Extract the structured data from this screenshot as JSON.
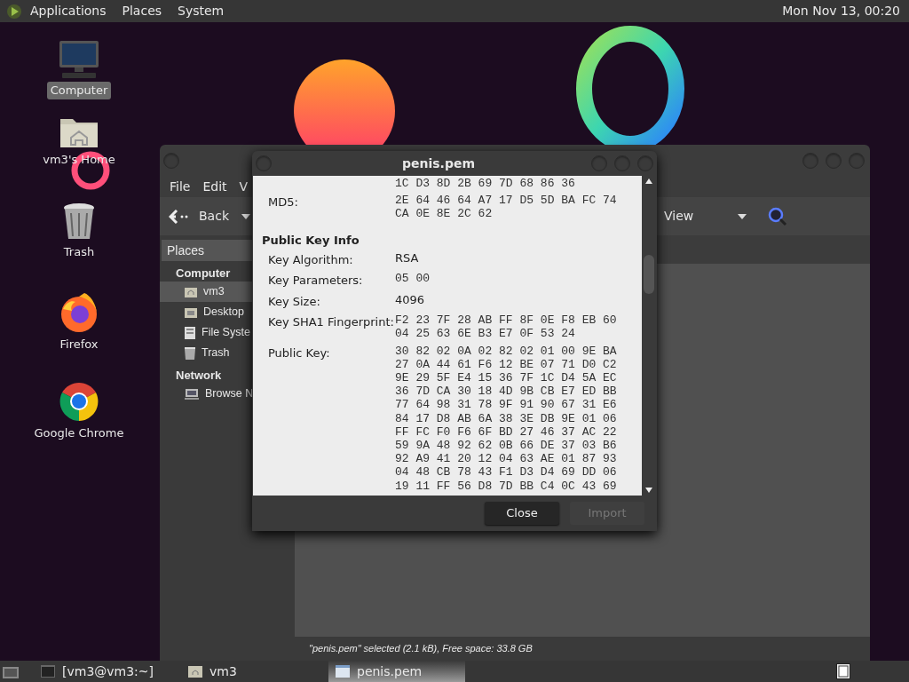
{
  "top_panel": {
    "menus": [
      "Applications",
      "Places",
      "System"
    ],
    "clock": "Mon Nov 13, 00:20"
  },
  "desktop_icons": [
    {
      "kind": "computer",
      "label": "Computer",
      "selected": true
    },
    {
      "kind": "home",
      "label": "vm3's Home",
      "selected": false
    },
    {
      "kind": "trash",
      "label": "Trash",
      "selected": false
    },
    {
      "kind": "firefox",
      "label": "Firefox",
      "selected": false
    },
    {
      "kind": "chrome",
      "label": "Google Chrome",
      "selected": false
    }
  ],
  "file_manager": {
    "menu": [
      "File",
      "Edit",
      "V"
    ],
    "toolbar": {
      "back": "Back",
      "view": "View"
    },
    "sidebar": {
      "header": "Places",
      "sections": [
        {
          "title": "Computer",
          "items": [
            {
              "kind": "home",
              "label": "vm3",
              "selected": true
            },
            {
              "kind": "desktop",
              "label": "Desktop",
              "selected": false
            },
            {
              "kind": "drive",
              "label": "File Syste",
              "selected": false
            },
            {
              "kind": "trash",
              "label": "Trash",
              "selected": false
            }
          ]
        },
        {
          "title": "Network",
          "items": [
            {
              "kind": "network",
              "label": "Browse N",
              "selected": false
            }
          ]
        }
      ]
    },
    "status_bar": "\"penis.pem\" selected (2.1 kB), Free space: 33.8 GB"
  },
  "dialog": {
    "title": "penis.pem",
    "rows": [
      {
        "kind": "hex",
        "lines": [
          "1C D3 8D 2B 69 7D 68 86 36"
        ]
      },
      {
        "kind": "hex",
        "label": "MD5:",
        "lines": [
          "2E 64 46 64 A7 17 D5 5D BA FC 74",
          "CA 0E 8E 2C 62"
        ]
      },
      {
        "kind": "heading",
        "label": "Public Key Info"
      },
      {
        "kind": "text",
        "label": "Key Algorithm:",
        "lines": [
          "RSA"
        ]
      },
      {
        "kind": "hex",
        "label": "Key Parameters:",
        "lines": [
          "05 00"
        ]
      },
      {
        "kind": "text",
        "label": "Key Size:",
        "lines": [
          "4096"
        ]
      },
      {
        "kind": "hex",
        "label": "Key SHA1 Fingerprint:",
        "lines": [
          "F2 23 7F 28 AB FF 8F 0E F8 EB 60",
          "04 25 63 6E B3 E7 0F 53 24"
        ]
      },
      {
        "kind": "hex",
        "label": "Public Key:",
        "lines": [
          "30 82 02 0A 02 82 02 01 00 9E BA",
          "27 0A 44 61 F6 12 BE 07 71 D0 C2",
          "9E 29 5F E4 15 36 7F 1C D4 5A EC",
          "36 7D CA 30 18 4D 9B CB E7 ED BB",
          "77 64 98 31 78 9F 91 90 67 31 E6",
          "84 17 D8 AB 6A 38 3E DB 9E 01 06",
          "FF FC F0 F6 6F BD 27 46 37 AC 22",
          "59 9A 48 92 62 0B 66 DE 37 03 B6",
          "92 A9 41 20 12 04 63 AE 01 87 93",
          "04 48 CB 78 43 F1 D3 D4 69 DD 06",
          "19 11 FF 56 D8 7D BB C4 0C 43 69"
        ]
      }
    ],
    "buttons": [
      {
        "label": "Close",
        "disabled": false
      },
      {
        "label": "Import",
        "disabled": true
      }
    ]
  },
  "taskbar": {
    "items": [
      {
        "kind": "terminal",
        "label": "[vm3@vm3:~]",
        "selected": false
      },
      {
        "kind": "folder",
        "label": "vm3",
        "selected": false
      },
      {
        "kind": "window",
        "label": "penis.pem",
        "selected": true
      }
    ]
  }
}
